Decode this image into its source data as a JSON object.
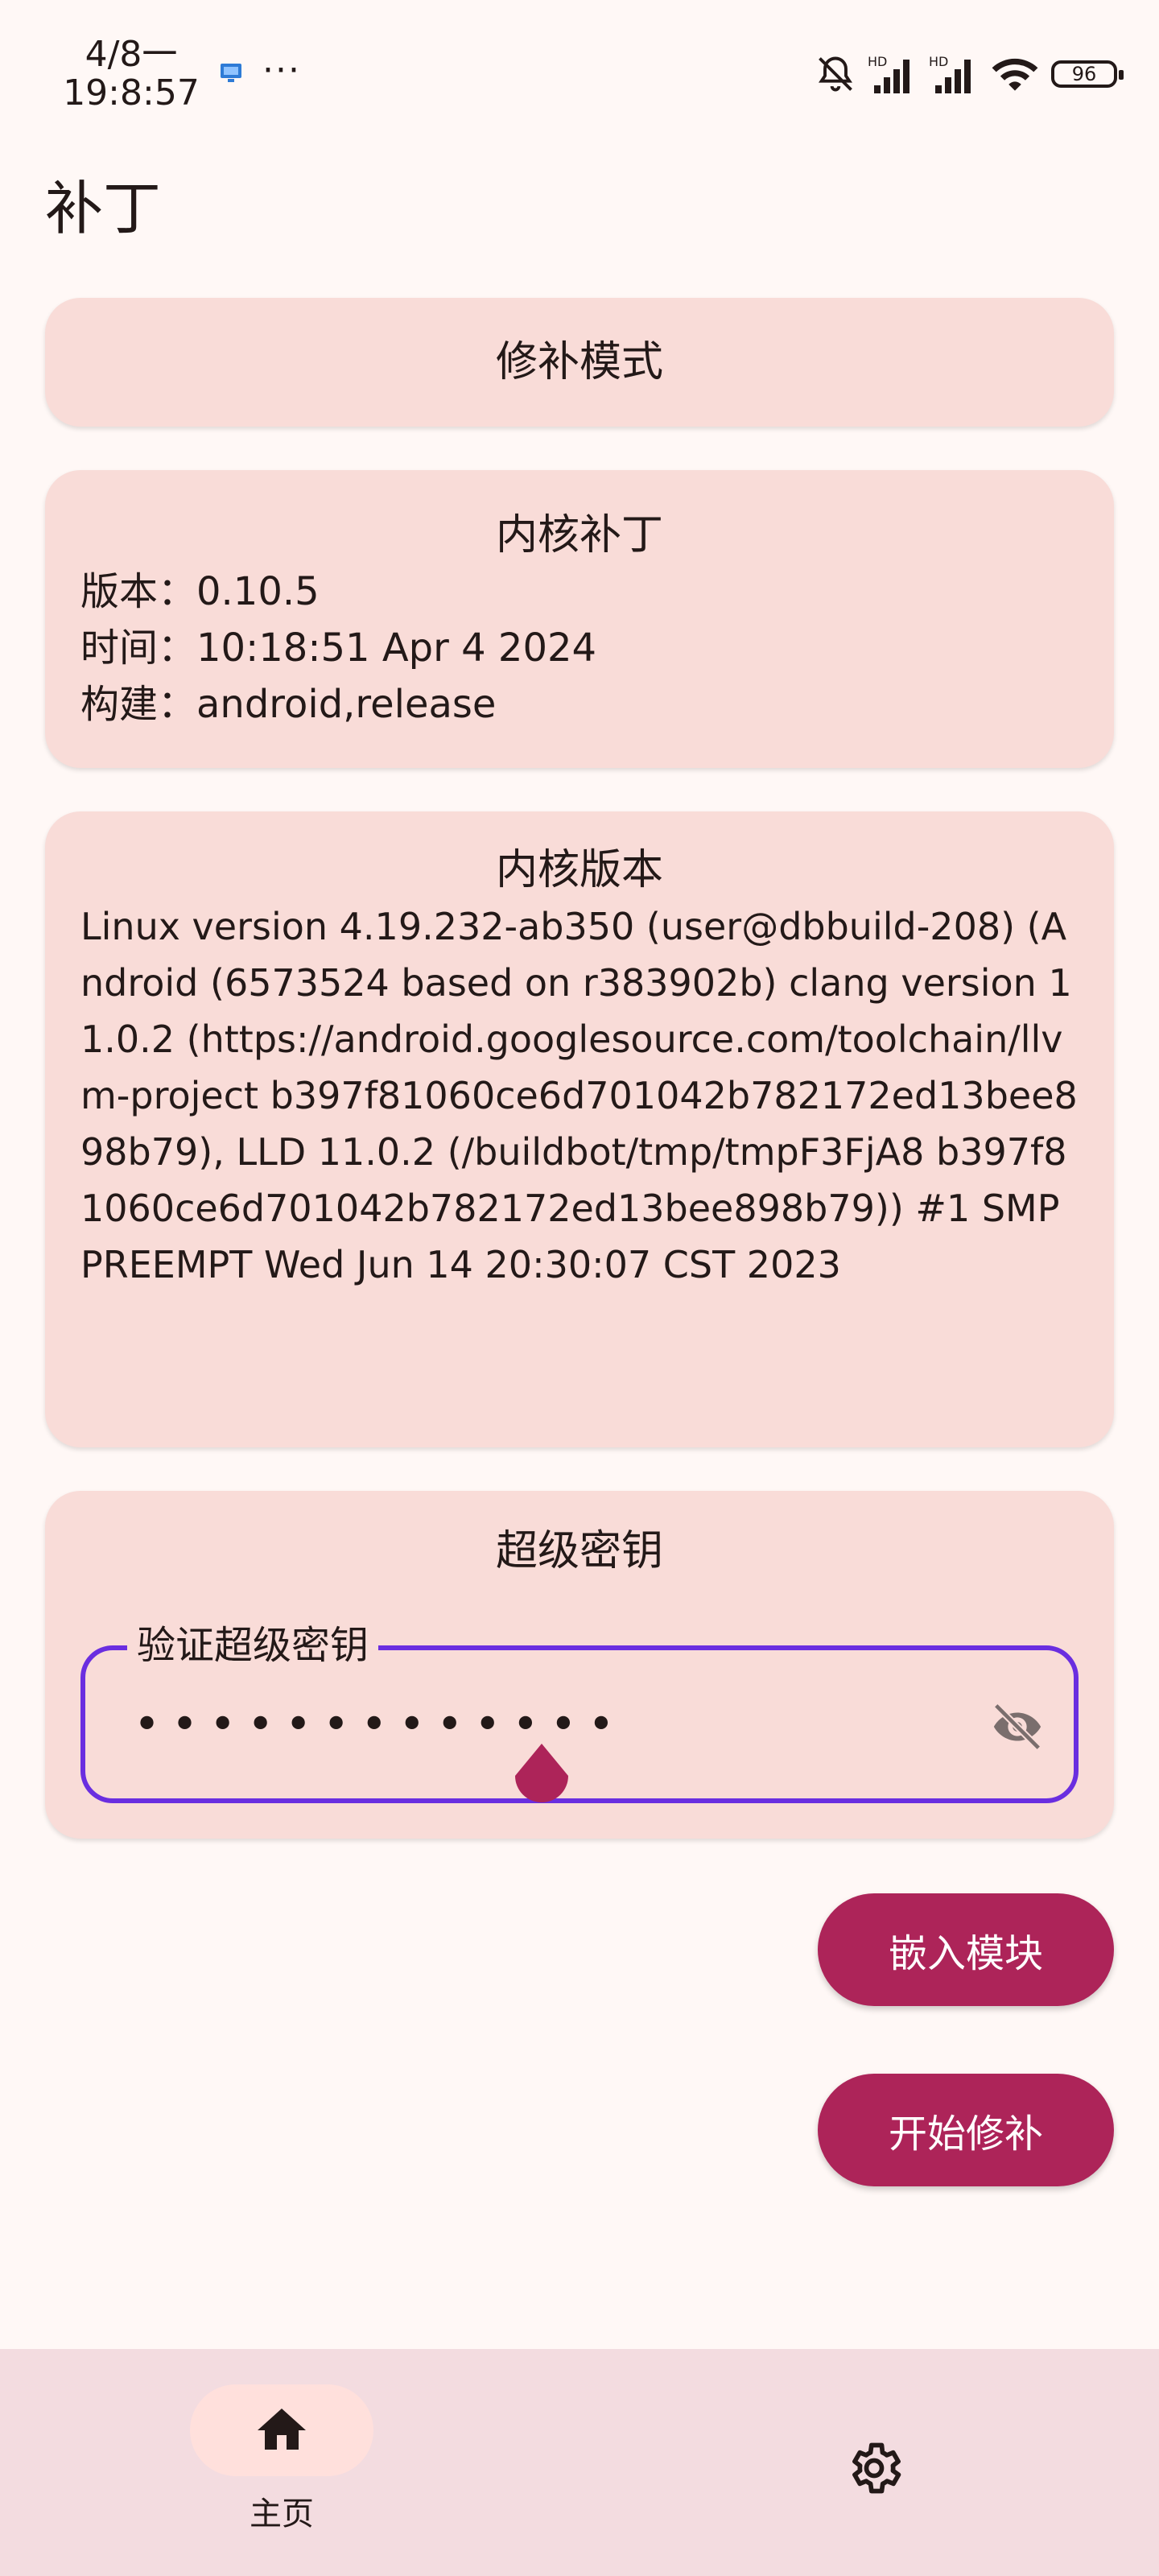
{
  "status": {
    "date": "4/8一",
    "time": "19:8:57",
    "more": "···",
    "battery": "96"
  },
  "page_title": "补丁",
  "mode_card": {
    "title": "修补模式"
  },
  "patch_card": {
    "title": "内核补丁",
    "version": "版本：0.10.5",
    "time": "时间：10:18:51 Apr  4 2024",
    "build": "构建：android,release"
  },
  "kernel_card": {
    "title": "内核版本",
    "text": "Linux version 4.19.232-ab350 (user@dbbuild-208) (Android (6573524 based on r383902b) clang version 11.0.2 (https://android.googlesource.com/toolchain/llvm-project b397f81060ce6d701042b782172ed13bee898b79), LLD 11.0.2 (/buildbot/tmp/tmpF3FjA8 b397f81060ce6d701042b782172ed13bee898b79)) #1 SMP PREEMPT Wed Jun 14 20:30:07 CST 2023"
  },
  "key_card": {
    "title": "超级密钥",
    "field_label": "验证超级密钥",
    "field_value": "•••••••••••••"
  },
  "buttons": {
    "embed": "嵌入模块",
    "start_patch": "开始修补"
  },
  "nav": {
    "home_label": "主页"
  },
  "colors": {
    "background": "#FFF8F6",
    "card": "#F9DCD8",
    "primary": "#AD2459",
    "field_border": "#6A2EE0",
    "nav_bg": "#F3DCE0"
  }
}
